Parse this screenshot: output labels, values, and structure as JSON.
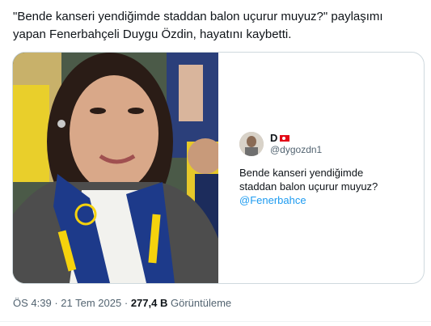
{
  "tweet": {
    "text": "\"Bende kanseri yendiğimde staddan balon uçurur muyuz?\" paylaşımı yapan Fenerbahçeli Duygu Özdin, hayatını kaybetti."
  },
  "quoted": {
    "name": "D",
    "handle": "@dygozdn1",
    "line1": "Bende kanseri yendiğimde",
    "line2": "staddan balon uçurur muyuz?",
    "mention": "@Fenerbahce",
    "flag_icon": "turkey-flag-icon"
  },
  "meta": {
    "time": "ÖS 4:39",
    "separator": "·",
    "date": "21 Tem 2025",
    "views_count": "277,4 B",
    "views_label": "Görüntüleme"
  },
  "colors": {
    "text": "#0f1419",
    "secondary": "#536471",
    "link": "#1d9bf0",
    "border": "#cfd9de",
    "team_navy": "#1d3a8a",
    "team_yellow": "#f5d20d"
  }
}
